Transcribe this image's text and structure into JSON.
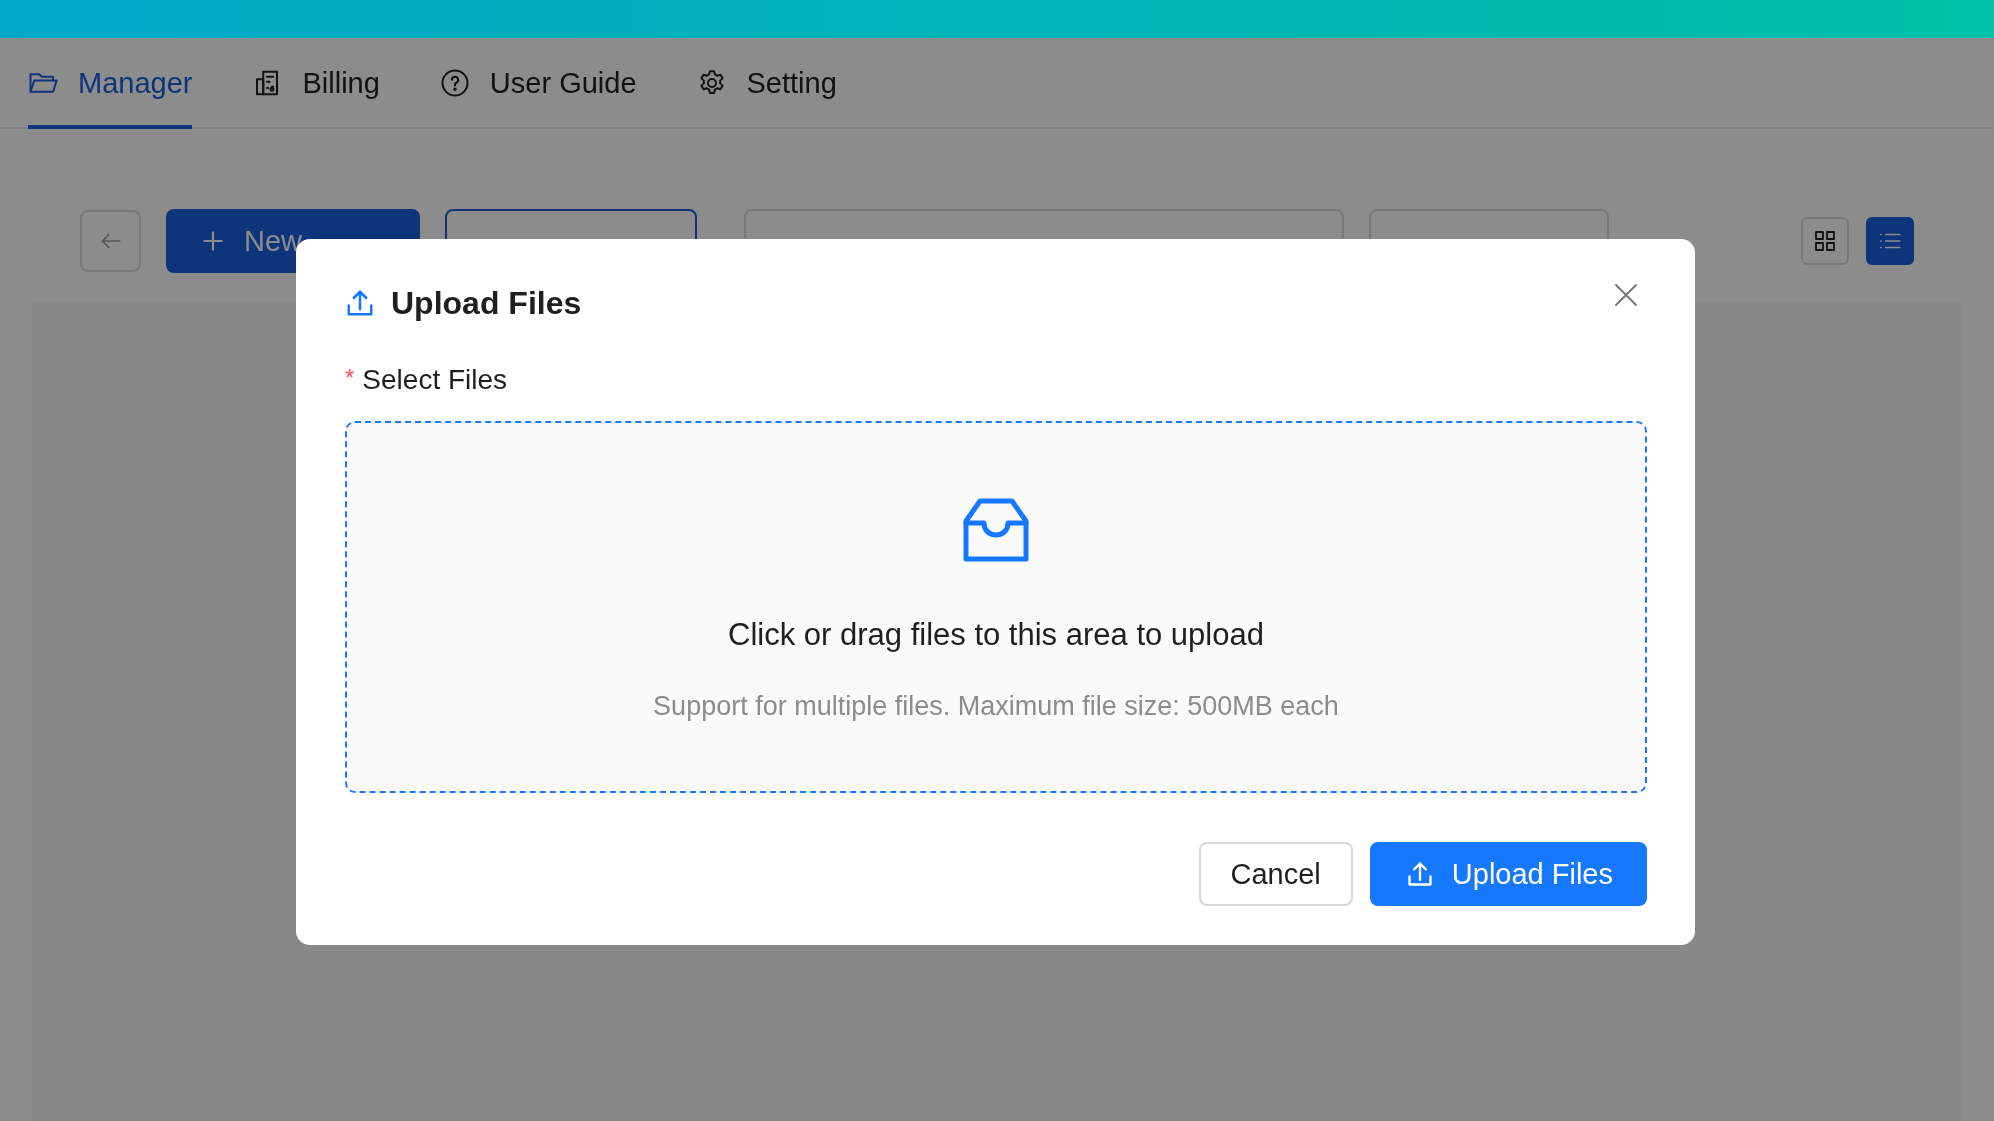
{
  "nav": {
    "tabs": [
      {
        "label": "Manager",
        "selected": true
      },
      {
        "label": "Billing",
        "selected": false
      },
      {
        "label": "User Guide",
        "selected": false
      },
      {
        "label": "Setting",
        "selected": false
      }
    ]
  },
  "toolbar": {
    "new_button": "New",
    "view_toggle": [
      {
        "kind": "grid",
        "selected": false
      },
      {
        "kind": "list",
        "selected": true
      }
    ]
  },
  "modal": {
    "title": "Upload Files",
    "required_mark": "*",
    "field_label": "Select Files",
    "dropzone": {
      "text": "Click or drag files to this area to upload",
      "hint": "Support for multiple files. Maximum file size: 500MB each"
    },
    "buttons": [
      {
        "label": "Cancel",
        "kind": "default"
      },
      {
        "label": "Upload Files",
        "kind": "primary"
      }
    ]
  }
}
